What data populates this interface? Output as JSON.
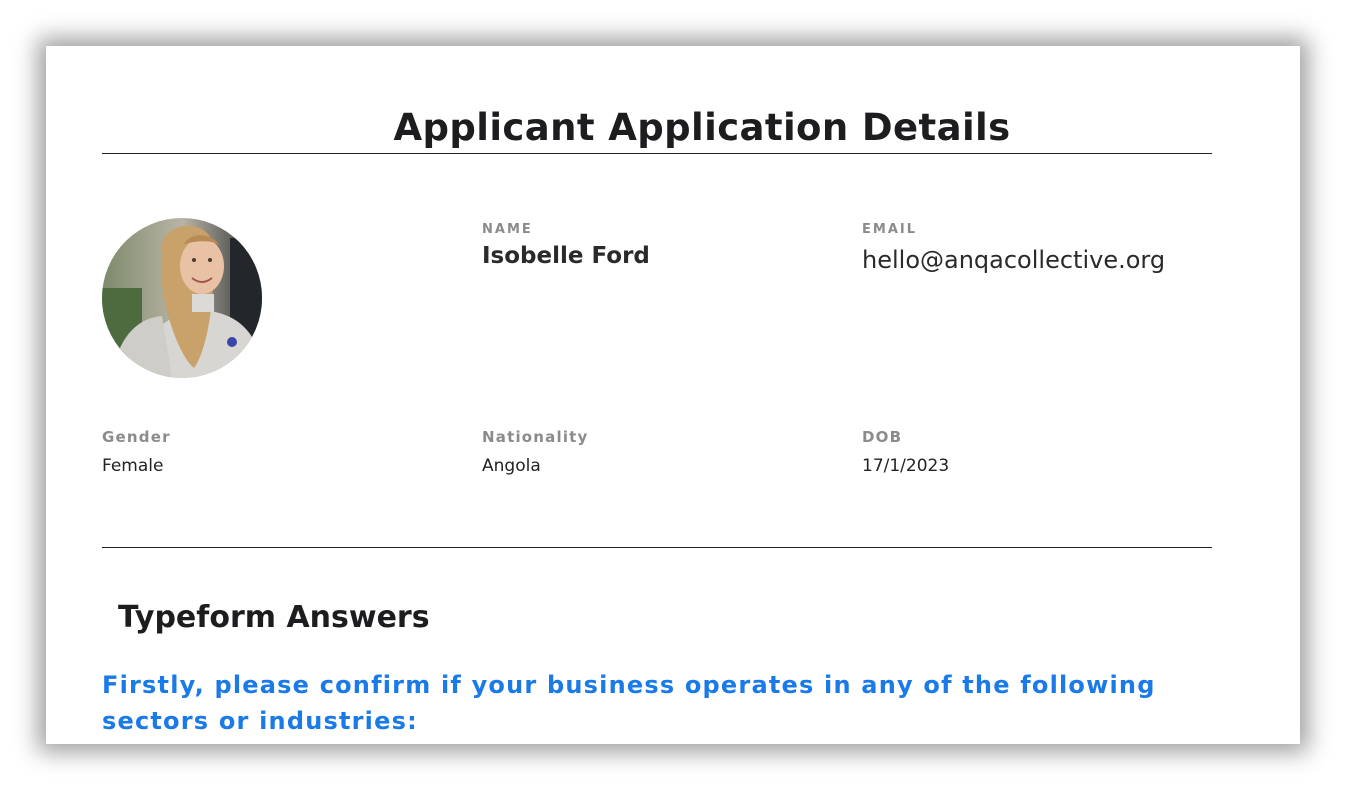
{
  "page": {
    "title": "Applicant Application Details"
  },
  "applicant": {
    "name_label": "NAME",
    "name": "Isobelle Ford",
    "email_label": "EMAIL",
    "email": "hello@anqacollective.org",
    "gender_label": "Gender",
    "gender": "Female",
    "nationality_label": "Nationality",
    "nationality": "Angola",
    "dob_label": "DOB",
    "dob": "17/1/2023"
  },
  "typeform": {
    "section_title": "Typeform Answers",
    "question": "Firstly, please confirm if your business operates in any of the following sectors or industries:"
  },
  "colors": {
    "accent_blue": "#1a7ae8",
    "label_gray": "#8b8b8b",
    "text_dark": "#1d1d1f"
  }
}
